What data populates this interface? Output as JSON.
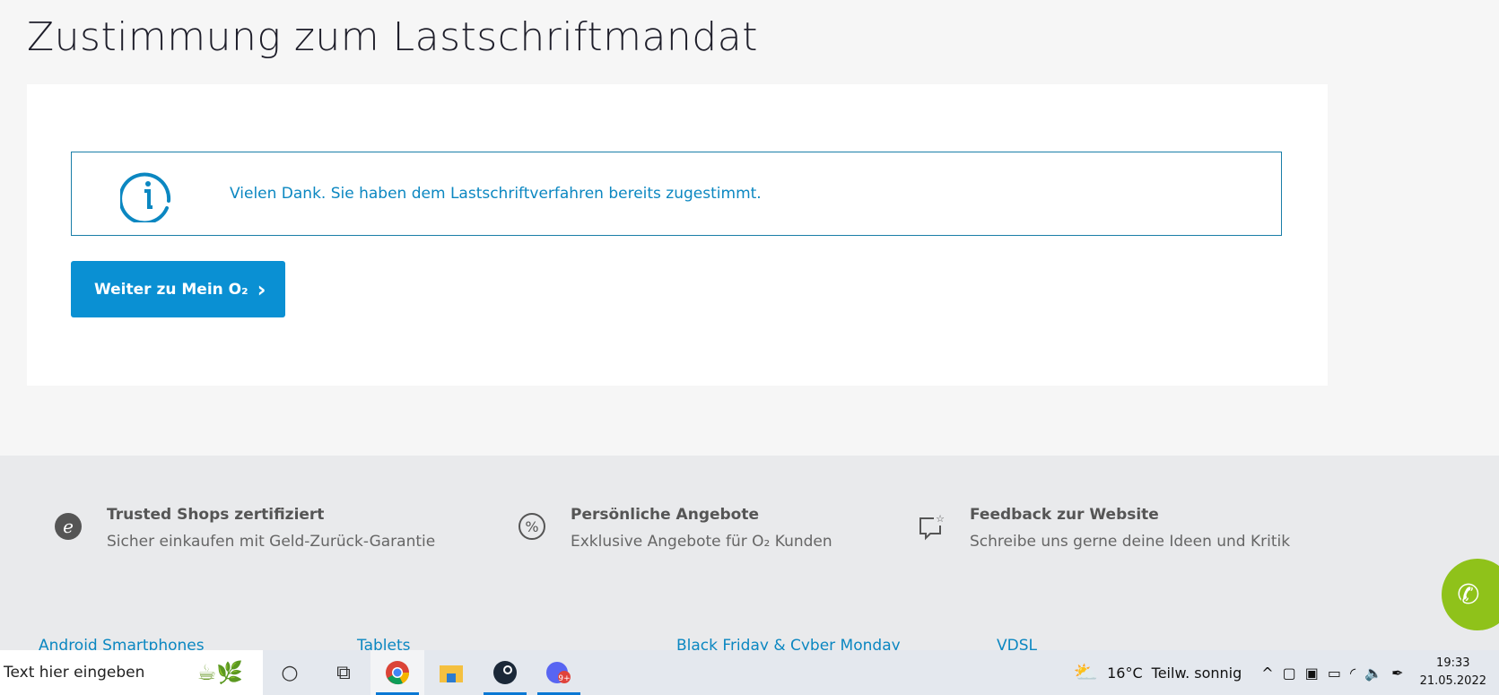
{
  "page": {
    "title": "Zustimmung zum Lastschriftmandat"
  },
  "info": {
    "icon": "info-icon",
    "message": "Vielen Dank. Sie haben dem Lastschriftverfahren bereits zugestimmt."
  },
  "button": {
    "label": "Weiter zu Mein O₂",
    "chevron": "›"
  },
  "features": [
    {
      "icon": "trusted-shops-icon",
      "title": "Trusted Shops zertifiziert",
      "subtitle": "Sicher einkaufen mit Geld-Zurück-Garantie"
    },
    {
      "icon": "percent-icon",
      "title": "Persönliche Angebote",
      "subtitle": "Exklusive Angebote für O₂ Kunden"
    },
    {
      "icon": "feedback-icon",
      "title": "Feedback zur Website",
      "subtitle": "Schreibe uns gerne deine Ideen und Kritik"
    }
  ],
  "links": [
    "Android Smartphones",
    "Tablets",
    "Black Friday & Cyber Monday",
    "VDSL"
  ],
  "colors": {
    "accent": "#0a90d3",
    "call": "#8fc21a"
  },
  "taskbar": {
    "search_placeholder": "Text hier eingeben",
    "weather": "16°C",
    "weather_text": "Teilw. sonnig",
    "time": "19:33",
    "date": "21.05.2022"
  }
}
